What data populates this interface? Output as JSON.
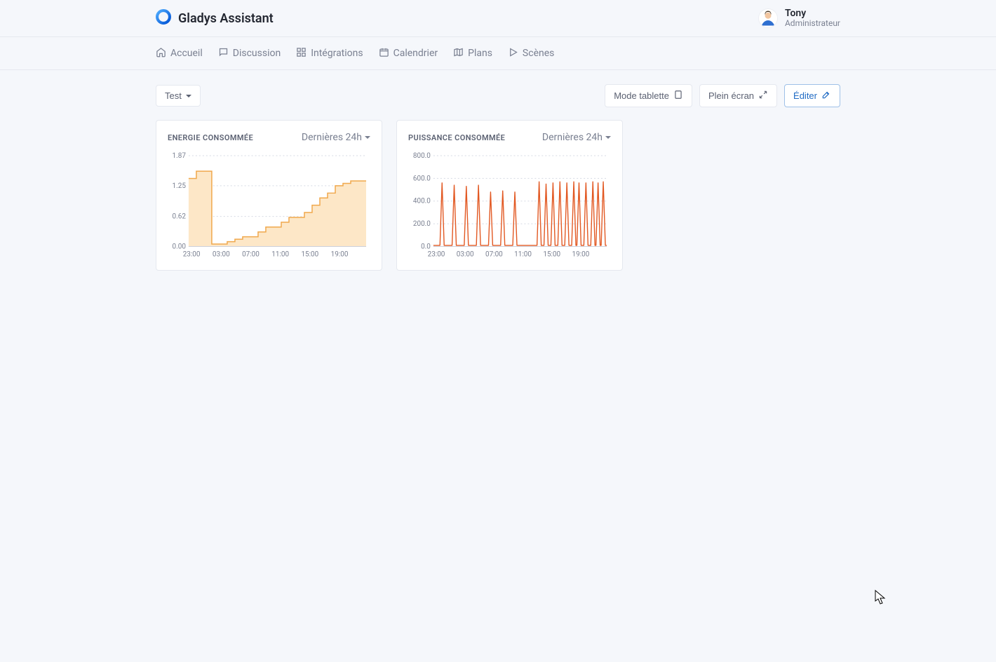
{
  "app": {
    "name": "Gladys Assistant"
  },
  "user": {
    "name": "Tony",
    "role": "Administrateur"
  },
  "nav": {
    "home": "Accueil",
    "discussion": "Discussion",
    "integrations": "Intégrations",
    "calendar": "Calendrier",
    "plans": "Plans",
    "scenes": "Scènes"
  },
  "toolbar": {
    "view_label": "Test",
    "tablet_label": "Mode tablette",
    "fullscreen_label": "Plein écran",
    "edit_label": "Éditer"
  },
  "cards": {
    "energy": {
      "title": "ENERGIE CONSOMMÉE",
      "range": "Dernières 24h"
    },
    "power": {
      "title": "PUISSANCE CONSOMMÉE",
      "range": "Dernières 24h"
    }
  },
  "chart_data": [
    {
      "id": "energy",
      "type": "area",
      "x": [
        "23:00",
        "00:00",
        "01:00",
        "02:00",
        "03:00",
        "04:00",
        "05:00",
        "06:00",
        "07:00",
        "08:00",
        "09:00",
        "10:00",
        "11:00",
        "12:00",
        "13:00",
        "14:00",
        "15:00",
        "16:00",
        "17:00",
        "18:00",
        "19:00",
        "20:00",
        "21:00",
        "22:00"
      ],
      "x_ticks": [
        "23:00",
        "03:00",
        "07:00",
        "11:00",
        "15:00",
        "19:00"
      ],
      "y_ticks": [
        "0.00",
        "0.62",
        "1.25",
        "1.87"
      ],
      "ylim": [
        0,
        1.87
      ],
      "values": [
        1.4,
        1.55,
        1.55,
        0.05,
        0.05,
        0.1,
        0.15,
        0.2,
        0.2,
        0.3,
        0.4,
        0.4,
        0.5,
        0.6,
        0.6,
        0.7,
        0.85,
        1.0,
        1.1,
        1.25,
        1.3,
        1.35,
        1.35,
        1.35
      ],
      "color_stroke": "#f0a84c",
      "color_fill": "#fde7c7",
      "title": "ENERGIE CONSOMMÉE",
      "ylabel": "",
      "xlabel": ""
    },
    {
      "id": "power",
      "type": "line",
      "x_ticks": [
        "23:00",
        "03:00",
        "07:00",
        "11:00",
        "15:00",
        "19:00"
      ],
      "y_ticks": [
        "0.0",
        "200.0",
        "400.0",
        "600.0",
        "800.0"
      ],
      "ylim": [
        0,
        800
      ],
      "peaks": [
        {
          "t": 0.05,
          "v": 560
        },
        {
          "t": 0.12,
          "v": 540
        },
        {
          "t": 0.19,
          "v": 530
        },
        {
          "t": 0.26,
          "v": 540
        },
        {
          "t": 0.33,
          "v": 480
        },
        {
          "t": 0.4,
          "v": 490
        },
        {
          "t": 0.47,
          "v": 480
        },
        {
          "t": 0.61,
          "v": 570
        },
        {
          "t": 0.65,
          "v": 550
        },
        {
          "t": 0.69,
          "v": 560
        },
        {
          "t": 0.73,
          "v": 570
        },
        {
          "t": 0.77,
          "v": 560
        },
        {
          "t": 0.81,
          "v": 570
        },
        {
          "t": 0.84,
          "v": 560
        },
        {
          "t": 0.88,
          "v": 560
        },
        {
          "t": 0.92,
          "v": 570
        },
        {
          "t": 0.95,
          "v": 560
        },
        {
          "t": 0.98,
          "v": 570
        }
      ],
      "baseline": 10,
      "color_stroke": "#e25822",
      "title": "PUISSANCE CONSOMMÉE",
      "ylabel": "",
      "xlabel": ""
    }
  ]
}
